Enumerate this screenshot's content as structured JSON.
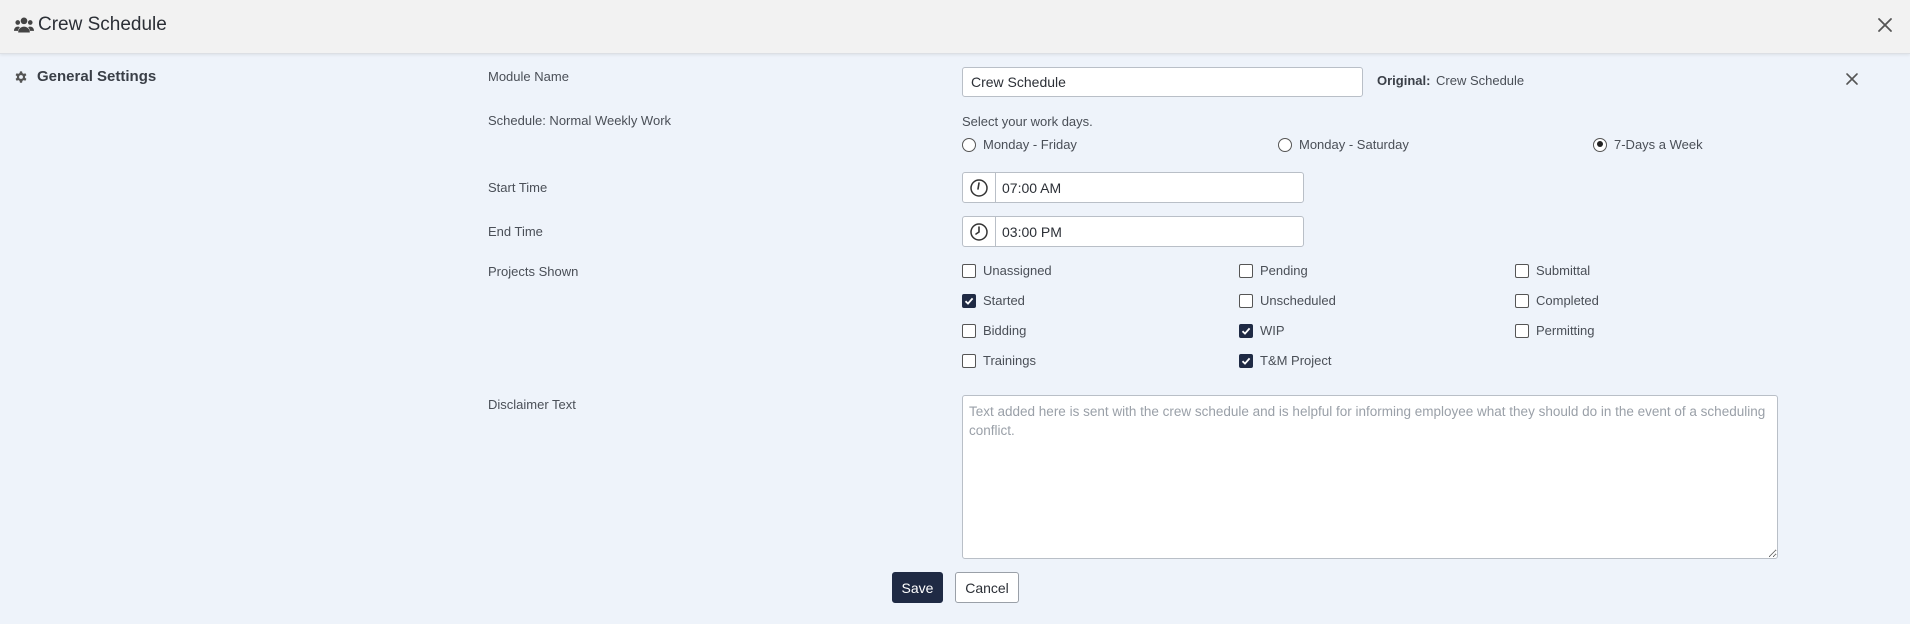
{
  "header": {
    "title": "Crew Schedule"
  },
  "sidebar": {
    "items": [
      {
        "label": "General Settings"
      }
    ]
  },
  "module_name": {
    "label": "Module Name",
    "value": "Crew Schedule",
    "original_label": "Original:",
    "original_value": "Crew Schedule"
  },
  "schedule": {
    "label": "Schedule: Normal Weekly Work",
    "hint": "Select your work days.",
    "options": [
      {
        "label": "Monday - Friday",
        "selected": false
      },
      {
        "label": "Monday - Saturday",
        "selected": false
      },
      {
        "label": "7-Days a Week",
        "selected": true
      }
    ]
  },
  "start_time": {
    "label": "Start Time",
    "value": "07:00 AM"
  },
  "end_time": {
    "label": "End Time",
    "value": "03:00 PM"
  },
  "projects_shown": {
    "label": "Projects Shown",
    "items": [
      {
        "label": "Unassigned",
        "checked": false
      },
      {
        "label": "Pending",
        "checked": false
      },
      {
        "label": "Submittal",
        "checked": false
      },
      {
        "label": "Started",
        "checked": true
      },
      {
        "label": "Unscheduled",
        "checked": false
      },
      {
        "label": "Completed",
        "checked": false
      },
      {
        "label": "Bidding",
        "checked": false
      },
      {
        "label": "WIP",
        "checked": true
      },
      {
        "label": "Permitting",
        "checked": false
      },
      {
        "label": "Trainings",
        "checked": false
      },
      {
        "label": "T&M Project",
        "checked": true
      }
    ]
  },
  "disclaimer": {
    "label": "Disclaimer Text",
    "value": "",
    "placeholder": "Text added here is sent with the crew schedule and is helpful for informing employee what they should do in the event of a scheduling conflict."
  },
  "actions": {
    "save_label": "Save",
    "cancel_label": "Cancel"
  },
  "colors": {
    "primary": "#1f2a44",
    "background": "#eef3fa",
    "header_bg": "#f2f2f2"
  },
  "icons": {
    "title": "users-icon",
    "sidebar": "gear-icon",
    "close": "close-icon",
    "clock": "clock-icon"
  }
}
